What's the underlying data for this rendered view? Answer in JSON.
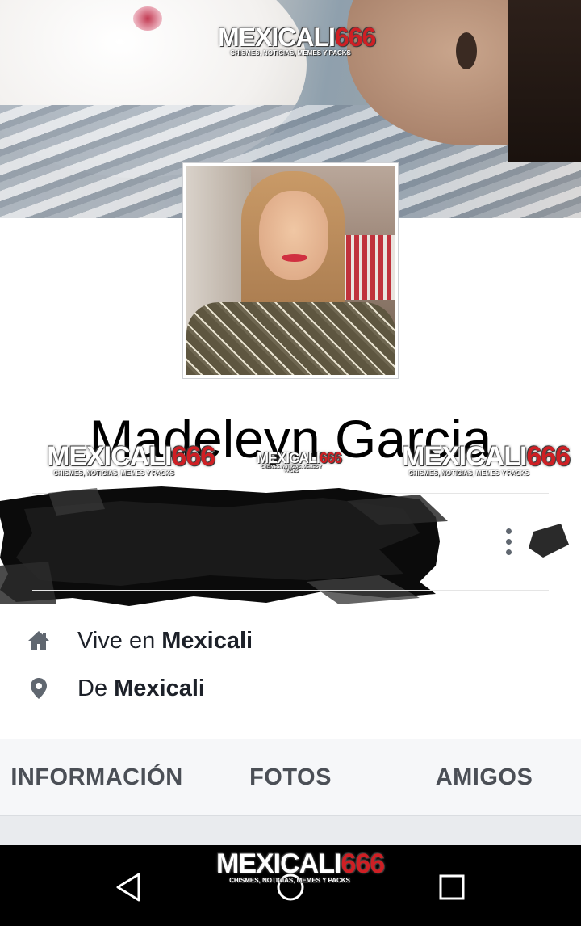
{
  "cover": {
    "alt": "cover photo"
  },
  "watermark": {
    "brand_white": "MEXICALI",
    "brand_red": "666",
    "tagline": "CHISMES, NOTICIAS, MEMES Y PACKS"
  },
  "profile": {
    "name": "Madeleyn Garcia"
  },
  "info": {
    "lives_in_prefix": "Vive en ",
    "lives_in_value": "Mexicali",
    "from_prefix": "De ",
    "from_value": "Mexicali"
  },
  "tabs": [
    {
      "label": "INFORMACIÓN"
    },
    {
      "label": "FOTOS"
    },
    {
      "label": "AMIGOS"
    }
  ],
  "colors": {
    "text": "#1d2129",
    "icon": "#606770",
    "tab_text": "#4b4f56",
    "watermark_red": "#cf1f24"
  },
  "icons": {
    "home": "home-icon",
    "location": "location-pin-icon",
    "more": "more-vertical-icon",
    "back": "back-icon",
    "home_nav": "home-circle-icon",
    "recent": "recent-apps-icon"
  }
}
